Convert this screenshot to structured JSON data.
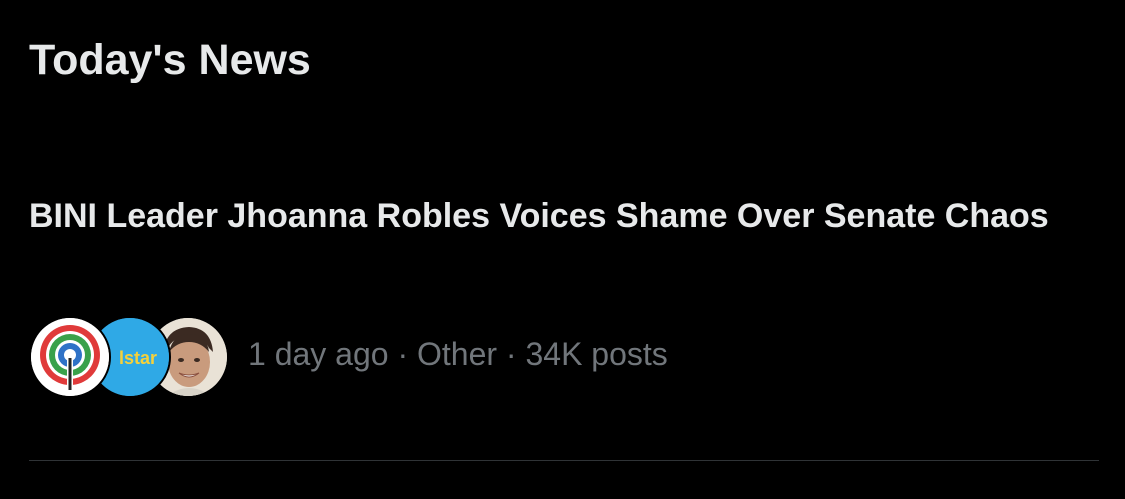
{
  "section": {
    "title": "Today's News"
  },
  "news_item": {
    "headline": "BINI Leader Jhoanna Robles Voices Shame Over Senate Chaos",
    "meta": {
      "time": "1 day ago",
      "separator": " · ",
      "category": "Other",
      "posts": "34K posts"
    },
    "avatars": [
      {
        "icon": "abs-cbn-logo-icon"
      },
      {
        "icon": "istar-logo-icon",
        "text": "lstar"
      },
      {
        "icon": "user-photo-avatar"
      }
    ]
  },
  "colors": {
    "background": "#000000",
    "primary_text": "#e7e9ea",
    "secondary_text": "#71767b",
    "divider": "#2f3336"
  }
}
